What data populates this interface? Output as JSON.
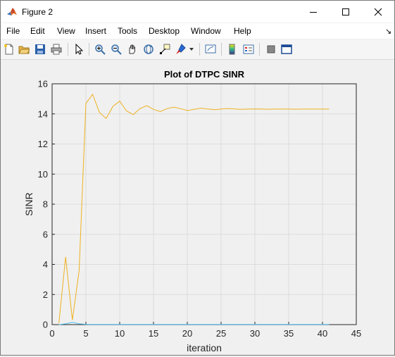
{
  "window": {
    "title": "Figure 2"
  },
  "menu": {
    "items": [
      "File",
      "Edit",
      "View",
      "Insert",
      "Tools",
      "Desktop",
      "Window",
      "Help"
    ]
  },
  "toolbar": {
    "icons": [
      "new-figure-icon",
      "open-file-icon",
      "save-icon",
      "print-icon",
      "pointer-icon",
      "zoom-in-icon",
      "zoom-out-icon",
      "pan-hand-icon",
      "rotate-3d-icon",
      "data-cursor-icon",
      "brush-icon",
      "link-plot-icon",
      "colorbar-icon",
      "legend-icon",
      "hide-plot-tools-icon",
      "show-plot-tools-icon"
    ]
  },
  "colors": {
    "series1": "#EDB120",
    "series2": "#4DBEEE",
    "grid": "#dcdcdc"
  },
  "chart_data": {
    "type": "line",
    "title": "Plot of DTPC SINR",
    "xlabel": "iteration",
    "ylabel": "SINR",
    "xlim": [
      0,
      45
    ],
    "ylim": [
      0,
      16
    ],
    "xticks": [
      0,
      5,
      10,
      15,
      20,
      25,
      30,
      35,
      40,
      45
    ],
    "yticks": [
      0,
      2,
      4,
      6,
      8,
      10,
      12,
      14,
      16
    ],
    "grid": true,
    "series": [
      {
        "color": "#EDB120",
        "x": [
          1,
          2,
          3,
          4,
          5,
          6,
          7,
          8,
          9,
          10,
          11,
          12,
          13,
          14,
          15,
          16,
          17,
          18,
          19,
          20,
          21,
          22,
          23,
          24,
          25,
          26,
          27,
          28,
          29,
          30,
          31,
          32,
          33,
          34,
          35,
          36,
          37,
          38,
          39,
          40,
          41
        ],
        "y": [
          0.1,
          4.5,
          0.3,
          3.6,
          14.7,
          15.3,
          14.1,
          13.7,
          14.5,
          14.85,
          14.2,
          13.95,
          14.35,
          14.55,
          14.3,
          14.15,
          14.35,
          14.45,
          14.35,
          14.22,
          14.3,
          14.38,
          14.33,
          14.28,
          14.32,
          14.36,
          14.33,
          14.3,
          14.32,
          14.33,
          14.32,
          14.31,
          14.32,
          14.32,
          14.32,
          14.31,
          14.32,
          14.32,
          14.32,
          14.32,
          14.32
        ]
      },
      {
        "color": "#4DBEEE",
        "x": [
          1,
          2,
          3,
          4,
          5,
          6,
          7,
          8,
          9,
          10,
          15,
          20,
          25,
          30,
          35,
          40,
          41
        ],
        "y": [
          0,
          0.05,
          0.15,
          0.05,
          0.02,
          0.01,
          0.01,
          0.01,
          0.01,
          0.01,
          0.01,
          0.01,
          0.01,
          0.01,
          0.01,
          0.01,
          0.01
        ]
      }
    ]
  }
}
